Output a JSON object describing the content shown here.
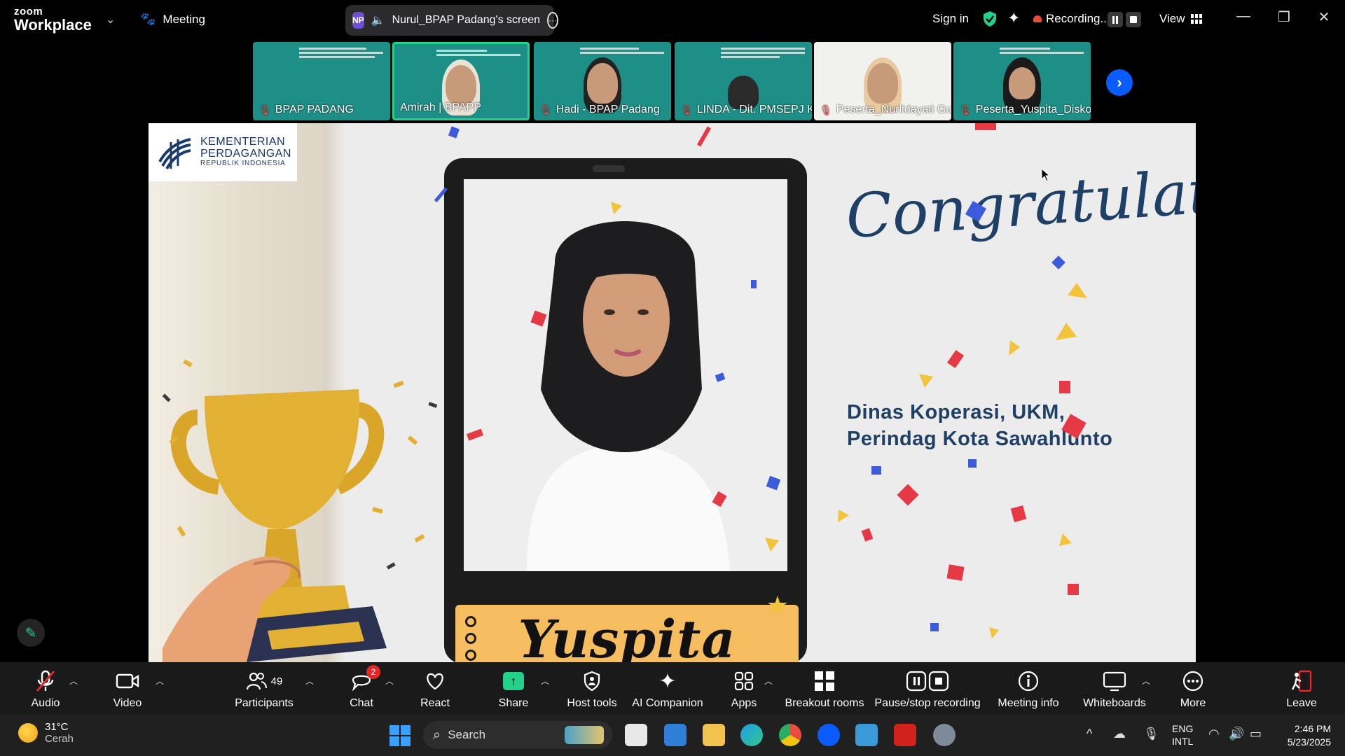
{
  "topbar": {
    "brand_top": "zoom",
    "brand_bottom": "Workplace",
    "meeting": "Meeting",
    "share_avatar": "NP",
    "share_text": "Nurul_BPAP Padang's screen",
    "signin": "Sign in",
    "recording": "Recording...",
    "view": "View"
  },
  "filmstrip": [
    {
      "name": "BPAP PADANG"
    },
    {
      "name": "Amirah | BPAPP"
    },
    {
      "name": "Hadi - BPAP Padang"
    },
    {
      "name": "LINDA - Dit. PMSEPJ K..."
    },
    {
      "name": "Peserta_Nurlidayati Gu..."
    },
    {
      "name": "Peserta_Yuspita_Disko..."
    }
  ],
  "slide": {
    "logo_line1": "KEMENTERIAN",
    "logo_line2": "PERDAGANGAN",
    "logo_line3": "REPUBLIK INDONESIA",
    "heading": "Congratulations",
    "org_line1": "Dinas Koperasi, UKM,",
    "org_line2": "Perindag Kota Sawahlunto",
    "name": "Yuspita"
  },
  "toolbar": {
    "audio": "Audio",
    "video": "Video",
    "participants": "Participants",
    "participants_count": "49",
    "chat": "Chat",
    "chat_badge": "2",
    "react": "React",
    "share": "Share",
    "host_tools": "Host tools",
    "ai_companion": "AI Companion",
    "apps": "Apps",
    "breakout": "Breakout rooms",
    "pause_stop": "Pause/stop recording",
    "meeting_info": "Meeting info",
    "whiteboards": "Whiteboards",
    "more": "More",
    "leave": "Leave"
  },
  "taskbar": {
    "temp": "31°C",
    "condition": "Cerah",
    "search": "Search",
    "lang1": "ENG",
    "lang2": "INTL",
    "time": "2:46 PM",
    "date": "5/23/2025"
  },
  "colors": {
    "accent_green": "#23d18b",
    "zoom_blue": "#0b5cff",
    "record_red": "#e84c3d",
    "slide_navy": "#1e3f66",
    "nameplate": "#f6bd60"
  }
}
